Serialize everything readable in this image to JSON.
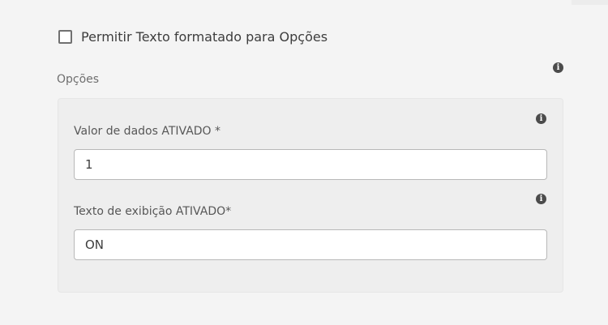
{
  "rich_text_option": {
    "label": "Permitir Texto formatado para Opções",
    "checked": false
  },
  "options_section": {
    "label": "Opções",
    "info_icon": "i"
  },
  "fields": {
    "on_value": {
      "label": "Valor de dados ATIVADO *",
      "value": "1",
      "info_icon": "i"
    },
    "on_text": {
      "label": "Texto de exibição ATIVADO*",
      "value": "ON",
      "info_icon": "i"
    }
  }
}
